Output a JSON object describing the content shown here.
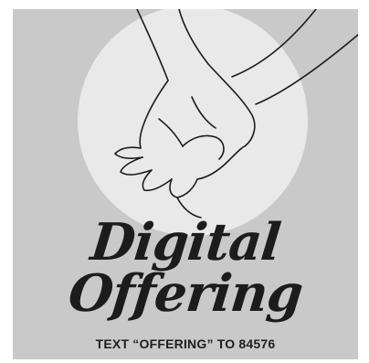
{
  "poster": {
    "title_line_1": "Digital",
    "title_line_2": "Offering",
    "call_to_action": "TEXT “OFFERING” TO 84576",
    "illustration": "holding-hands-icon"
  },
  "colors": {
    "background": "#c9c9c9",
    "circle": "#e9e9e9",
    "ink": "#1c1c1c"
  }
}
